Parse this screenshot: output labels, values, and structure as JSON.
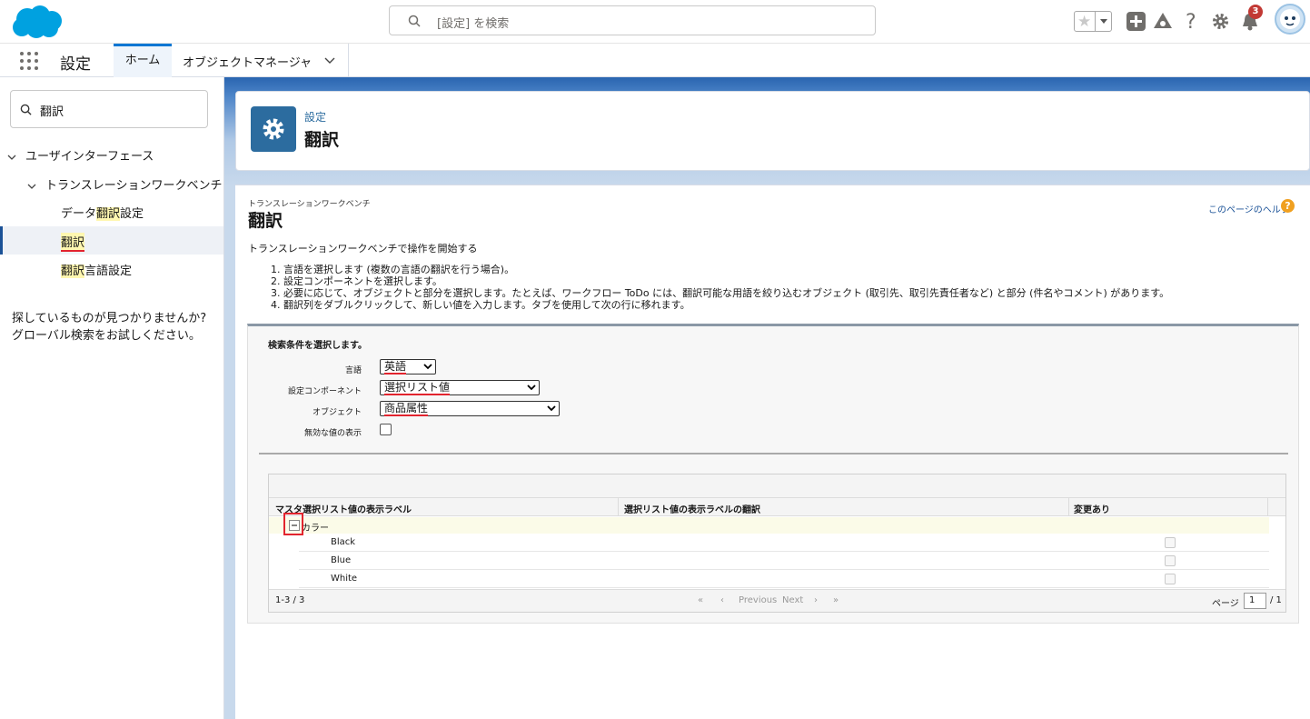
{
  "header": {
    "search_placeholder": "[設定] を検索",
    "notification_count": "3"
  },
  "nav": {
    "app_title": "設定",
    "tabs": [
      {
        "label": "ホーム"
      },
      {
        "label": "オブジェクトマネージャ"
      }
    ]
  },
  "sidebar": {
    "search_value": "翻訳",
    "tree": {
      "level1": "ユーザインターフェース",
      "level2": "トランスレーションワークベンチ",
      "items": [
        {
          "prefix": "データ",
          "highlight": "翻訳",
          "suffix": "設定"
        },
        {
          "prefix": "",
          "highlight": "翻訳",
          "suffix": ""
        },
        {
          "prefix": "",
          "highlight": "翻訳",
          "suffix": "言語設定"
        }
      ]
    },
    "not_found_line1": "探しているものが見つかりませんか?",
    "not_found_line2": "グローバル検索をお試しください。"
  },
  "page_header": {
    "breadcrumb": "設定",
    "title": "翻訳"
  },
  "content": {
    "subtitle": "トランスレーションワークベンチ",
    "title": "翻訳",
    "help_link": "このページのヘルプ",
    "intro": "トランスレーションワークベンチで操作を開始する",
    "steps": [
      "1. 言語を選択します (複数の言語の翻訳を行う場合)。",
      "2. 設定コンポーネントを選択します。",
      "3. 必要に応じて、オブジェクトと部分を選択します。たとえば、ワークフロー ToDo には、翻訳可能な用語を絞り込むオブジェクト (取引先、取引先責任者など) と部分 (件名やコメント) があります。",
      "4. 翻訳列をダブルクリックして、新しい値を入力します。タブを使用して次の行に移れます。"
    ]
  },
  "filters": {
    "heading": "検索条件を選択します。",
    "language_label": "言語",
    "language_value": "英語",
    "component_label": "設定コンポーネント",
    "component_value": "選択リスト値",
    "object_label": "オブジェクト",
    "object_value": "商品属性",
    "inactive_label": "無効な値の表示"
  },
  "grid": {
    "columns": [
      "マスタ選択リスト値の表示ラベル",
      "選択リスト値の表示ラベルの翻訳",
      "変更あり"
    ],
    "group_label": "カラー",
    "rows": [
      {
        "value": "Black"
      },
      {
        "value": "Blue"
      },
      {
        "value": "White"
      }
    ],
    "footer": {
      "count": "1-3 / 3",
      "previous": "Previous",
      "next": "Next",
      "page_label": "ページ",
      "page_value": "1",
      "page_total": "/ 1"
    }
  }
}
